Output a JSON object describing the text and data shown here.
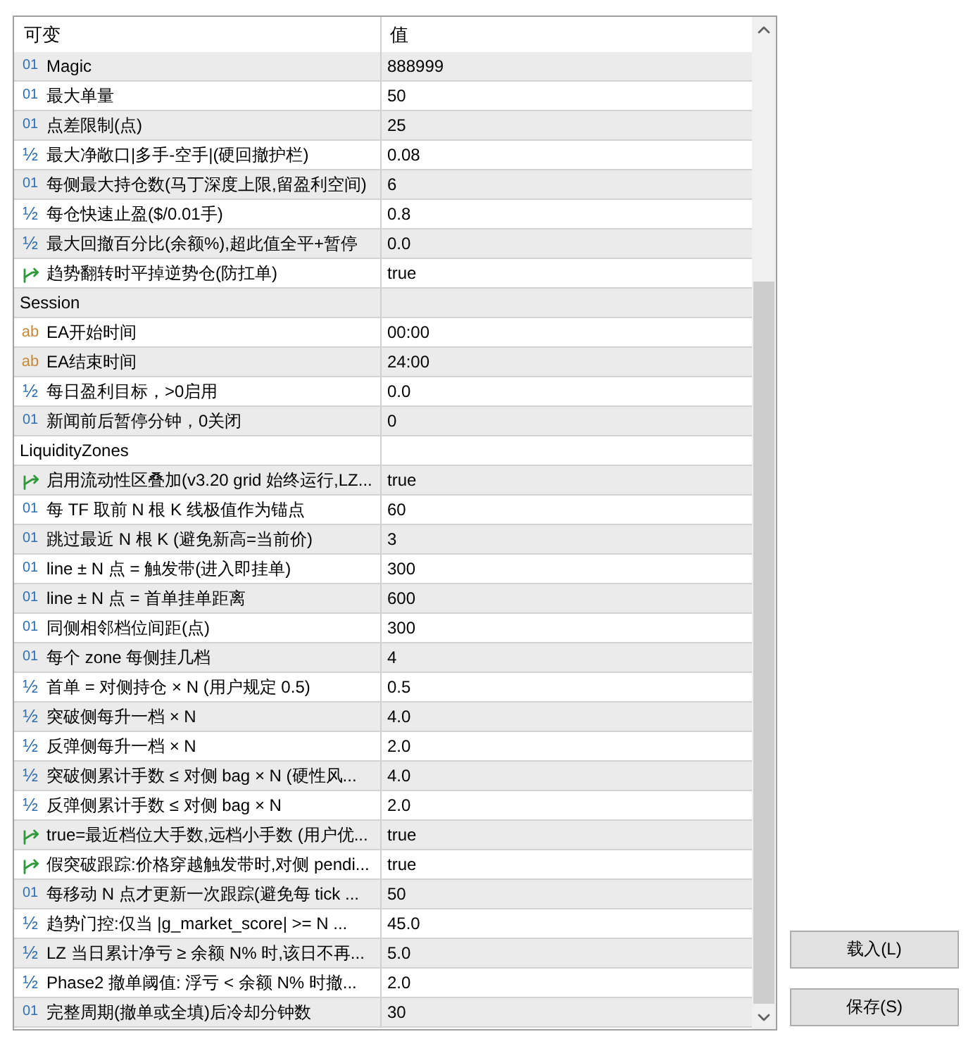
{
  "table": {
    "columns": [
      "可变",
      "值"
    ],
    "rows": [
      {
        "kind": "int",
        "icon": "01",
        "name": "Magic",
        "value": "888999"
      },
      {
        "kind": "int",
        "icon": "01",
        "name": "最大单量",
        "value": "50"
      },
      {
        "kind": "int",
        "icon": "01",
        "name": "点差限制(点)",
        "value": "25"
      },
      {
        "kind": "double",
        "icon": "½",
        "name": "最大净敞口|多手-空手|(硬回撤护栏)",
        "value": "0.08"
      },
      {
        "kind": "int",
        "icon": "01",
        "name": "每侧最大持仓数(马丁深度上限,留盈利空间)",
        "value": "6"
      },
      {
        "kind": "double",
        "icon": "½",
        "name": "每仓快速止盈($/0.01手)",
        "value": "0.8"
      },
      {
        "kind": "double",
        "icon": "½",
        "name": "最大回撤百分比(余额%),超此值全平+暂停",
        "value": "0.0"
      },
      {
        "kind": "bool",
        "name": "趋势翻转时平掉逆势仓(防扛单)",
        "value": "true"
      },
      {
        "kind": "group",
        "name": "Session"
      },
      {
        "kind": "string",
        "icon": "ab",
        "name": "EA开始时间",
        "value": "00:00"
      },
      {
        "kind": "string",
        "icon": "ab",
        "name": "EA结束时间",
        "value": "24:00"
      },
      {
        "kind": "double",
        "icon": "½",
        "name": "每日盈利目标，>0启用",
        "value": "0.0"
      },
      {
        "kind": "int",
        "icon": "01",
        "name": "新闻前后暂停分钟，0关闭",
        "value": "0"
      },
      {
        "kind": "group",
        "name": "LiquidityZones"
      },
      {
        "kind": "bool",
        "name": "启用流动性区叠加(v3.20 grid 始终运行,LZ...",
        "value": "true"
      },
      {
        "kind": "int",
        "icon": "01",
        "name": "每 TF 取前 N 根 K 线极值作为锚点",
        "value": "60"
      },
      {
        "kind": "int",
        "icon": "01",
        "name": "跳过最近 N 根 K (避免新高=当前价)",
        "value": "3"
      },
      {
        "kind": "int",
        "icon": "01",
        "name": "line ± N 点 = 触发带(进入即挂单)",
        "value": "300"
      },
      {
        "kind": "int",
        "icon": "01",
        "name": "line ± N 点 = 首单挂单距离",
        "value": "600"
      },
      {
        "kind": "int",
        "icon": "01",
        "name": "同侧相邻档位间距(点)",
        "value": "300"
      },
      {
        "kind": "int",
        "icon": "01",
        "name": "每个 zone 每侧挂几档",
        "value": "4"
      },
      {
        "kind": "double",
        "icon": "½",
        "name": "首单 = 对侧持仓 × N (用户规定 0.5)",
        "value": "0.5"
      },
      {
        "kind": "double",
        "icon": "½",
        "name": "突破侧每升一档 × N",
        "value": "4.0"
      },
      {
        "kind": "double",
        "icon": "½",
        "name": "反弹侧每升一档 × N",
        "value": "2.0"
      },
      {
        "kind": "double",
        "icon": "½",
        "name": "突破侧累计手数 ≤ 对侧 bag × N (硬性风...",
        "value": "4.0"
      },
      {
        "kind": "double",
        "icon": "½",
        "name": "反弹侧累计手数 ≤ 对侧 bag × N",
        "value": "2.0"
      },
      {
        "kind": "bool",
        "name": "true=最近档位大手数,远档小手数 (用户优...",
        "value": "true"
      },
      {
        "kind": "bool",
        "name": "假突破跟踪:价格穿越触发带时,对侧 pendi...",
        "value": "true"
      },
      {
        "kind": "int",
        "icon": "01",
        "name": "每移动 N 点才更新一次跟踪(避免每 tick ...",
        "value": "50"
      },
      {
        "kind": "double",
        "icon": "½",
        "name": "趋势门控:仅当 |g_market_score| >= N ...",
        "value": "45.0"
      },
      {
        "kind": "double",
        "icon": "½",
        "name": "LZ 当日累计净亏 ≥ 余额 N% 时,该日不再...",
        "value": "5.0"
      },
      {
        "kind": "double",
        "icon": "½",
        "name": "Phase2 撤单阈值: 浮亏 < 余额 N% 时撤...",
        "value": "2.0"
      },
      {
        "kind": "int",
        "icon": "01",
        "name": "完整周期(撤单或全填)后冷却分钟数",
        "value": "30"
      }
    ]
  },
  "buttons": [
    {
      "label": "载入(L)"
    },
    {
      "label": "保存(S)"
    }
  ]
}
